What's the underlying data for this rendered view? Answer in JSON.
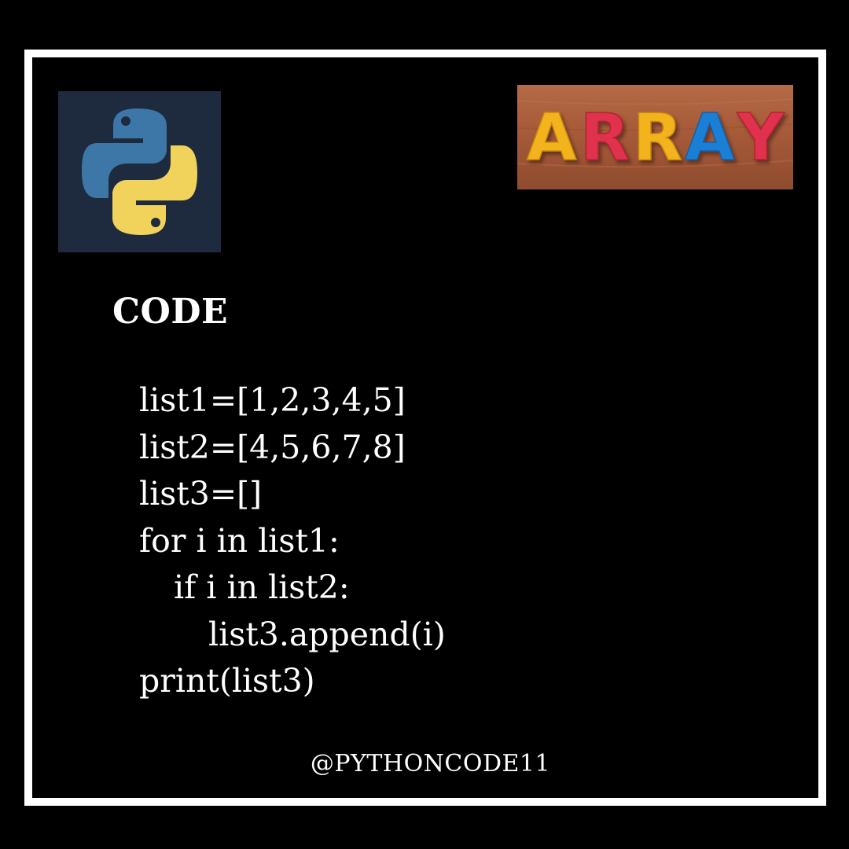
{
  "heading": "CODE",
  "code_lines": [
    "list1=[1,2,3,4,5]",
    "list2=[4,5,6,7,8]",
    "list3=[]",
    "for i in list1:",
    "if i in list2:",
    "list3.append(i)",
    "print(list3)"
  ],
  "footer": {
    "handle": "@PYTHONCODE11"
  },
  "images": {
    "python_logo": "python-logo-icon",
    "array_photo_text": "ARRAY",
    "array_letter_colors": [
      "#f2b31c",
      "#e0334e",
      "#f2b31c",
      "#1f7fd6",
      "#e0334e"
    ]
  },
  "colors": {
    "background": "#000000",
    "frame": "#ffffff",
    "text": "#ffffff",
    "python_blue": "#3d77a8",
    "python_yellow": "#f1d35c"
  }
}
